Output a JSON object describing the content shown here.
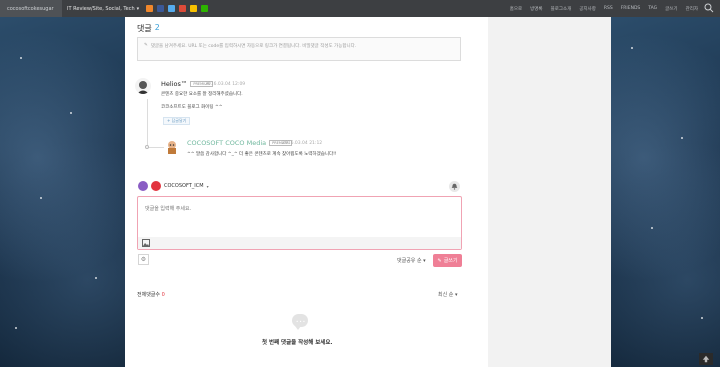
{
  "topbar": {
    "blog_name": "cocosoftcokesugar",
    "blog_select": "IT Review/Site, Social, Tech",
    "sns_icons": [
      {
        "name": "rss-icon",
        "color": "#f0872b"
      },
      {
        "name": "facebook-icon",
        "color": "#3b5998"
      },
      {
        "name": "twitter-icon",
        "color": "#55acee"
      },
      {
        "name": "googleplus-icon",
        "color": "#dd4b39"
      },
      {
        "name": "kakaostory-icon",
        "color": "#f7c100"
      },
      {
        "name": "naver-icon",
        "color": "#2db400"
      }
    ],
    "links": [
      "홈으로",
      "방명록",
      "블로그소개",
      "공지사항",
      "RSS",
      "FRIENDS",
      "TAG",
      "글쓰기",
      "관리자"
    ]
  },
  "comments": {
    "title": "댓글",
    "count": "2",
    "notice": "댓글을 남겨주세요. URL 또는 code를 입력하시면 자동으로 링크가 연결됩니다. 비밀댓글 작성도 가능합니다.",
    "items": [
      {
        "name": "Helios™",
        "badge": "PREMIUM",
        "date": "2016.03.04 12:09",
        "lines": [
          "콘텐츠 중요한 요소를 잘 정리해주셨습니다.",
          "코코소프트도 블로그 화이팅 ^^"
        ],
        "reply_button": "+ 답글달기"
      },
      {
        "name": "COCOSOFT COCO Media",
        "badge": "PREMIUM",
        "date": "2016.03.04 21:12",
        "lines": [
          "^^ 말씀 감사합니다 ^_^ 더 좋은 콘텐츠로 계속 찾아뵙도록 노력하겠습니다!!"
        ]
      }
    ]
  },
  "writer": {
    "name": "COCOSOFT_ICM",
    "textarea_placeholder": "댓글을 입력해 주세요.",
    "sort_option": "댓글공유 순",
    "submit_label": "글쓰기"
  },
  "list": {
    "total_label": "전체댓글수",
    "total_count": "0",
    "order_label": "최신 순",
    "empty_message": "첫 번째 댓글을 작성해 보세요."
  },
  "colors": {
    "accent_pink": "#ef7f96",
    "accent_blue": "#3aa0d8",
    "reply_name_green": "#6fb79d"
  }
}
